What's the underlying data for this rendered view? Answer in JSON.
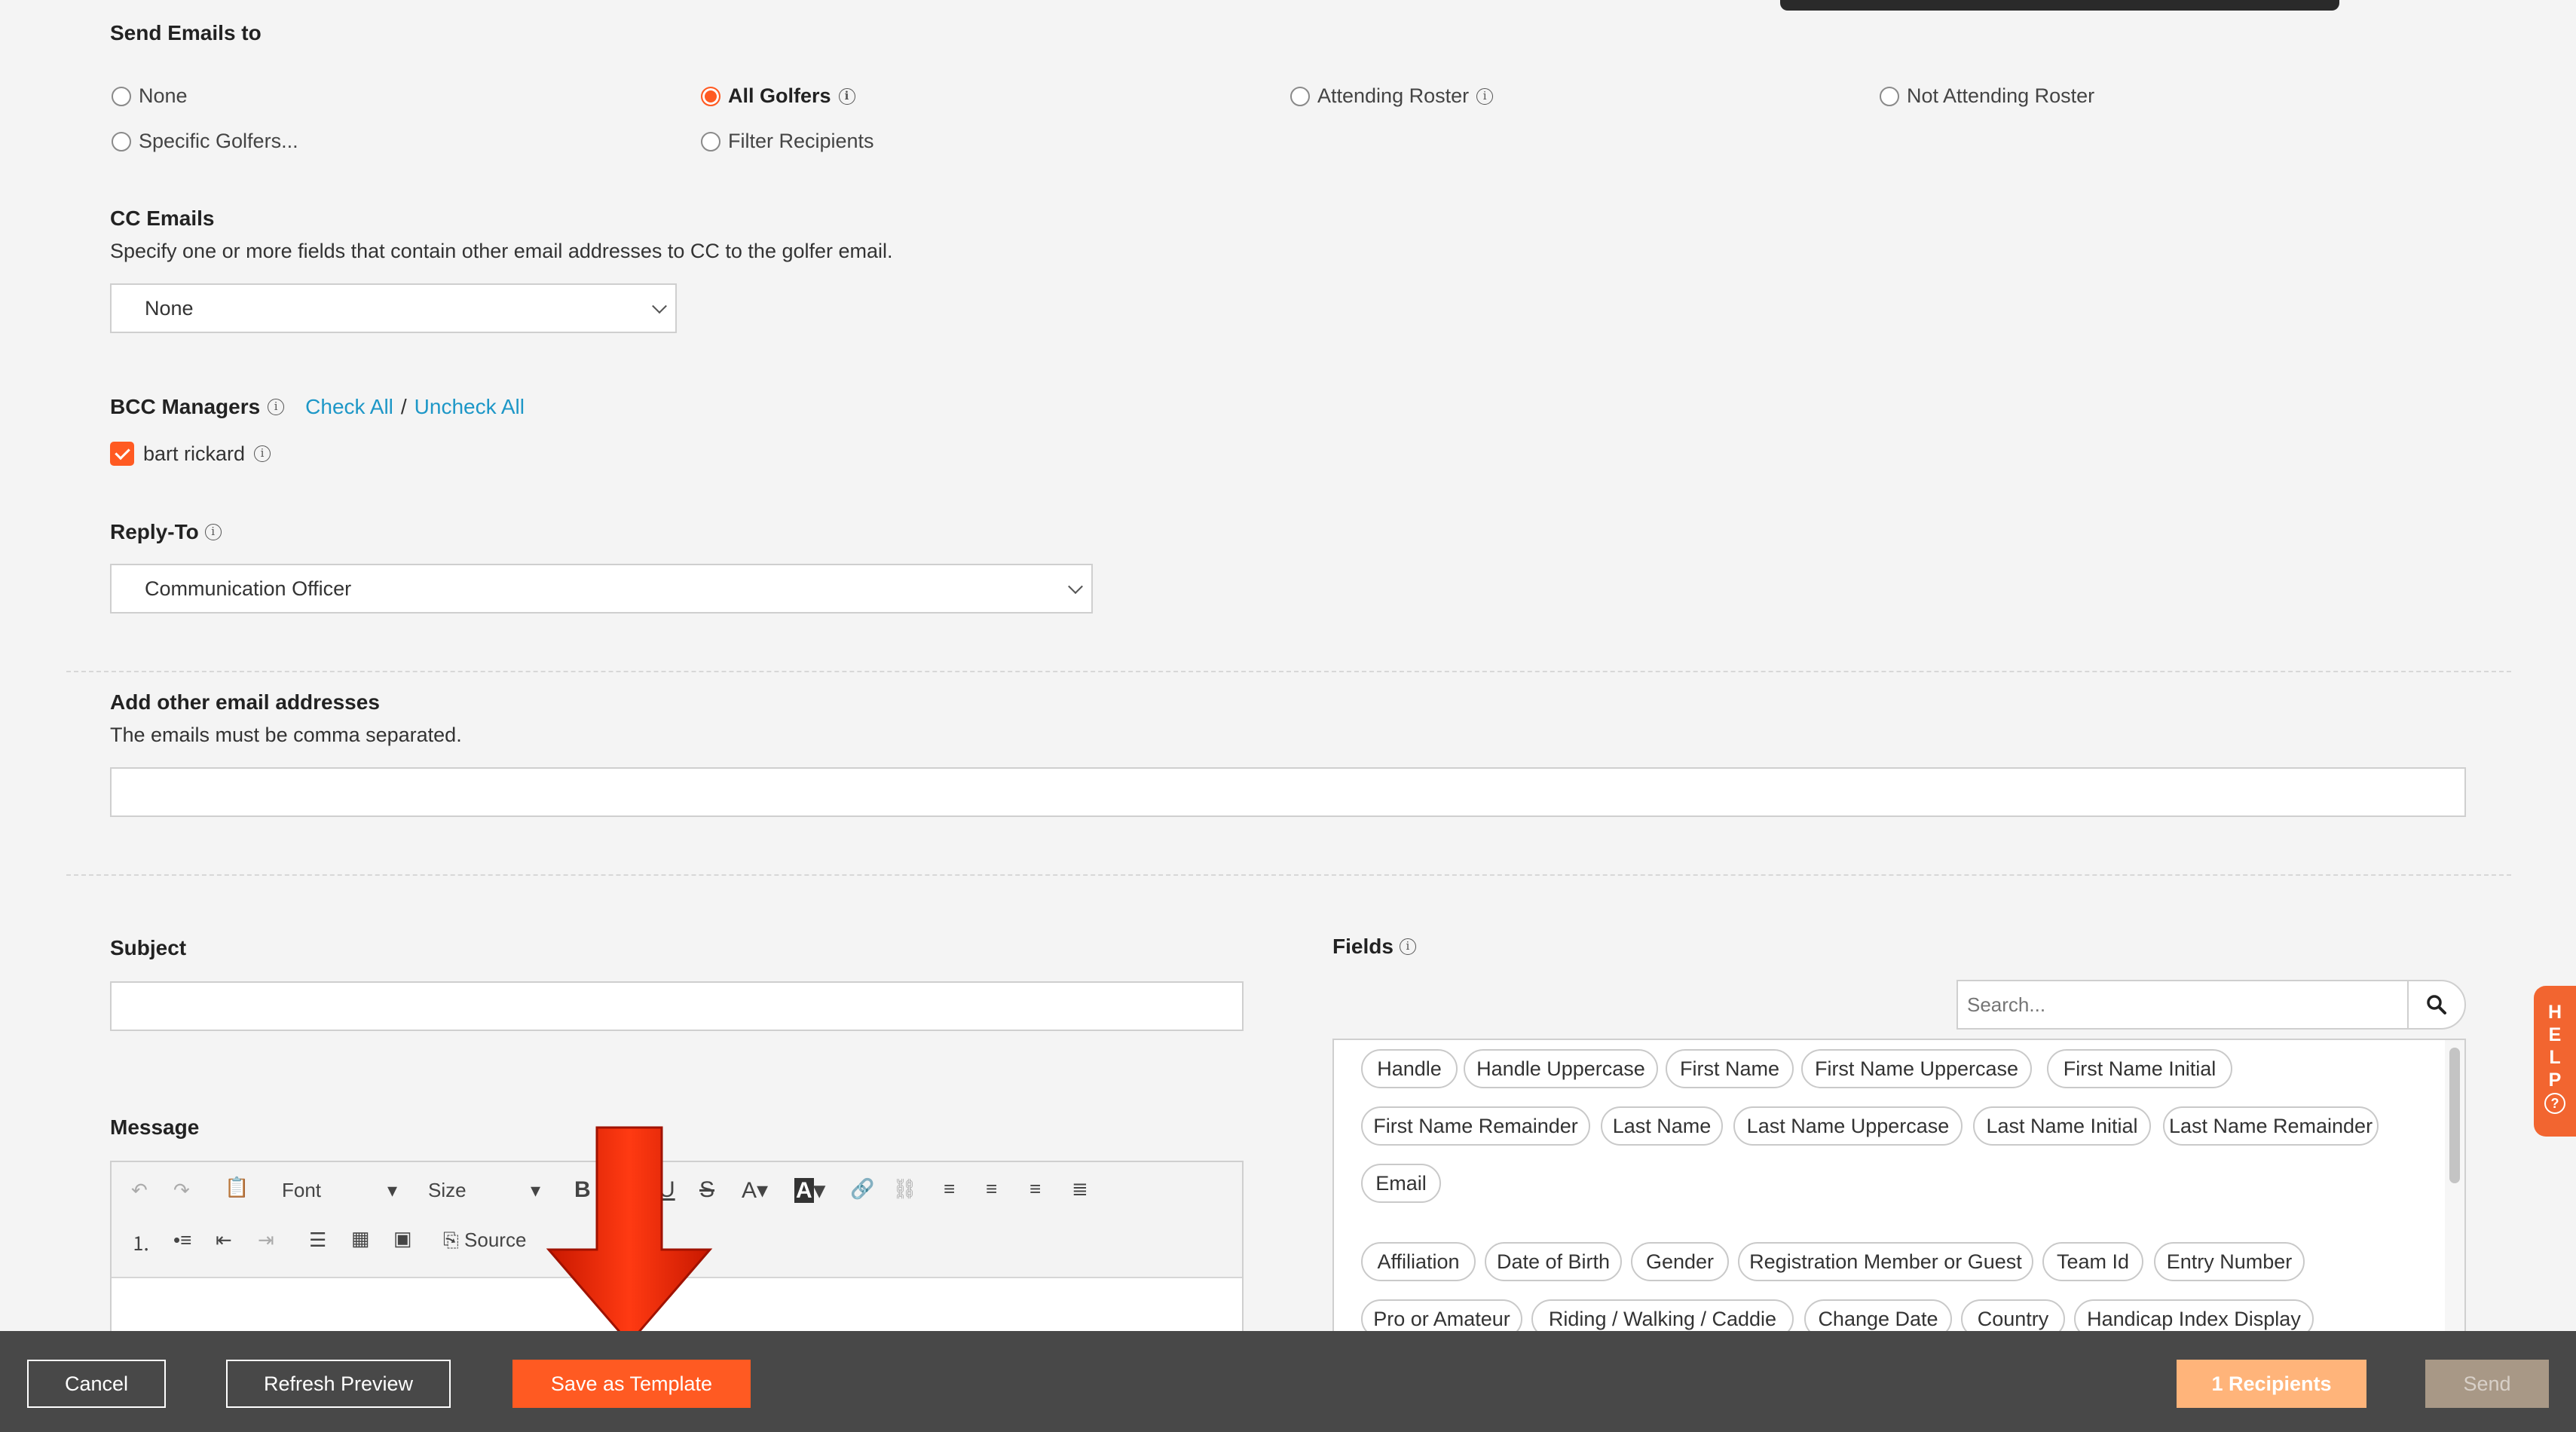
{
  "send_emails": {
    "heading": "Send Emails to",
    "options": [
      {
        "label": "None",
        "checked": false
      },
      {
        "label": "All Golfers",
        "checked": true
      },
      {
        "label": "Attending Roster",
        "checked": false
      },
      {
        "label": "Not Attending Roster",
        "checked": false
      },
      {
        "label": "Specific Golfers...",
        "checked": false
      },
      {
        "label": "Filter Recipients",
        "checked": false
      }
    ]
  },
  "cc": {
    "heading": "CC Emails",
    "description": "Specify one or more fields that contain other email addresses to CC to the golfer email.",
    "value": "None"
  },
  "bcc": {
    "heading": "BCC Managers",
    "check_all": "Check All",
    "separator": "/",
    "uncheck_all": "Uncheck All",
    "managers": [
      {
        "name": "bart rickard",
        "checked": true
      }
    ]
  },
  "reply_to": {
    "heading": "Reply-To",
    "value": "Communication Officer"
  },
  "other_emails": {
    "heading": "Add other email addresses",
    "description": "The emails must be comma separated.",
    "value": ""
  },
  "subject": {
    "heading": "Subject",
    "value": ""
  },
  "message": {
    "heading": "Message",
    "toolbar": {
      "font_label": "Font",
      "size_label": "Size",
      "source_label": "Source",
      "bold": "B",
      "underline": "U",
      "strike": "S",
      "text_color": "A",
      "bg_color": "A"
    }
  },
  "fields": {
    "heading": "Fields",
    "search_placeholder": "Search...",
    "chips_group1": [
      "Handle",
      "Handle Uppercase",
      "First Name",
      "First Name Uppercase",
      "First Name Initial",
      "First Name Remainder",
      "Last Name",
      "Last Name Uppercase",
      "Last Name Initial",
      "Last Name Remainder",
      "Email"
    ],
    "chips_group2": [
      "Affiliation",
      "Date of Birth",
      "Gender",
      "Registration Member or Guest",
      "Team Id",
      "Entry Number",
      "Pro or Amateur",
      "Riding / Walking / Caddie",
      "Change Date",
      "Country",
      "Handicap Index Display"
    ]
  },
  "help_tab": {
    "letters": [
      "H",
      "E",
      "L",
      "P",
      "?"
    ]
  },
  "footer": {
    "cancel": "Cancel",
    "refresh": "Refresh Preview",
    "save_template": "Save as Template",
    "recipients": "1 Recipients",
    "send": "Send"
  },
  "colors": {
    "accent": "#ff5a22",
    "link": "#1d97c7",
    "footer_bg": "#484848"
  }
}
